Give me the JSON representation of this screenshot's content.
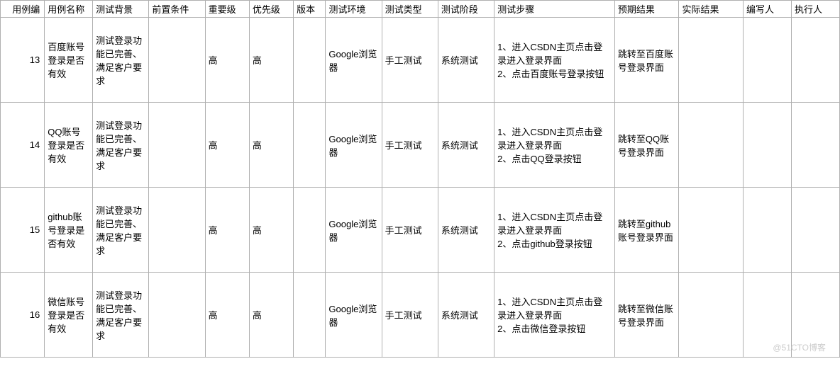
{
  "headers": {
    "id": "用例编",
    "name": "用例名称",
    "bg": "测试背景",
    "pre": "前置条件",
    "lvl": "重要级",
    "pri": "优先级",
    "ver": "版本",
    "env": "测试环境",
    "type": "测试类型",
    "phase": "测试阶段",
    "steps": "测试步骤",
    "expect": "预期结果",
    "actual": "实际结果",
    "author": "编写人",
    "exec": "执行人"
  },
  "rows": [
    {
      "id": "13",
      "name": "百度账号登录是否有效",
      "bg": "测试登录功能已完善、满足客户要求",
      "pre": "",
      "lvl": "高",
      "pri": "高",
      "ver": "",
      "env": "Google浏览器",
      "type": "手工测试",
      "phase": "系统测试",
      "steps": "1、进入CSDN主页点击登录进入登录界面\n2、点击百度账号登录按钮",
      "expect": "跳转至百度账号登录界面",
      "actual": "",
      "author": "",
      "exec": ""
    },
    {
      "id": "14",
      "name": "QQ账号登录是否有效",
      "bg": "测试登录功能已完善、满足客户要求",
      "pre": "",
      "lvl": "高",
      "pri": "高",
      "ver": "",
      "env": "Google浏览器",
      "type": "手工测试",
      "phase": "系统测试",
      "steps": "1、进入CSDN主页点击登录进入登录界面\n2、点击QQ登录按钮",
      "expect": "跳转至QQ账号登录界面",
      "actual": "",
      "author": "",
      "exec": ""
    },
    {
      "id": "15",
      "name": "github账号登录是否有效",
      "bg": "测试登录功能已完善、满足客户要求",
      "pre": "",
      "lvl": "高",
      "pri": "高",
      "ver": "",
      "env": "Google浏览器",
      "type": "手工测试",
      "phase": "系统测试",
      "steps": "1、进入CSDN主页点击登录进入登录界面\n2、点击github登录按钮",
      "expect": "跳转至github账号登录界面",
      "actual": "",
      "author": "",
      "exec": ""
    },
    {
      "id": "16",
      "name": "微信账号登录是否有效",
      "bg": "测试登录功能已完善、满足客户要求",
      "pre": "",
      "lvl": "高",
      "pri": "高",
      "ver": "",
      "env": "Google浏览器",
      "type": "手工测试",
      "phase": "系统测试",
      "steps": "1、进入CSDN主页点击登录进入登录界面\n2、点击微信登录按钮",
      "expect": "跳转至微信账号登录界面",
      "actual": "",
      "author": "",
      "exec": ""
    }
  ],
  "watermark": "@51CTO博客"
}
